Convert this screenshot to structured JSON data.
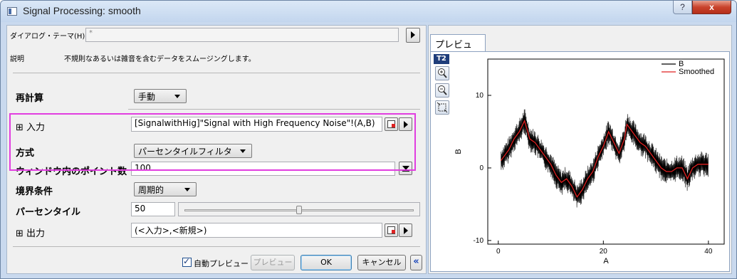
{
  "window": {
    "title": "Signal Processing: smooth",
    "help": "?",
    "close": "x"
  },
  "left": {
    "theme_label": "ダイアログ・テーマ(H)",
    "theme_value": "*",
    "description_label": "説明",
    "description_text": "不規則なあるいは雑音を含むデータをスムージングします。",
    "recalc_label": "再計算",
    "recalc_value": "手動",
    "input_label": "⊞ 入力",
    "input_value": "[SignalwithHig]\"Signal with High Frequency Noise\"!(A,B)",
    "method_label": "方式",
    "method_value": "パーセンタイルフィルタ",
    "points_label": "ウィンドウ内のポイント数",
    "points_value": "100",
    "boundary_label": "境界条件",
    "boundary_value": "周期的",
    "percentile_label": "パーセンタイル",
    "percentile_value": "50",
    "percentile_fraction": 0.5,
    "output_label": "⊞ 出力",
    "output_value": "(<入力>,<新規>)"
  },
  "buttons": {
    "auto_preview_label": "自動プレビュー",
    "auto_preview_checked": true,
    "preview": "プレビュー",
    "ok": "OK",
    "cancel": "キャンセル",
    "collapse": "«"
  },
  "preview": {
    "tab": "プレビュー",
    "layer_badge": "T2",
    "tools": [
      "zoom-in-icon",
      "zoom-out-icon",
      "rescale-icon"
    ]
  },
  "chart_data": {
    "type": "line",
    "xlabel": "A",
    "ylabel": "B",
    "xlim": [
      -2,
      43
    ],
    "ylim": [
      -10.5,
      15
    ],
    "xticks": [
      0,
      20,
      40
    ],
    "yticks": [
      -10,
      0,
      10
    ],
    "legend": {
      "position": "top-right",
      "entries": [
        {
          "name": "B",
          "color": "#000000"
        },
        {
          "name": "Smoothed",
          "color": "#e02020"
        }
      ]
    },
    "series": [
      {
        "name": "B",
        "color": "#000000",
        "noise_amplitude": 1.8
      },
      {
        "name": "Smoothed",
        "color": "#e02020",
        "x": [
          0.5,
          1,
          2,
          3,
          4,
          5,
          6,
          7,
          8,
          9,
          10,
          11,
          12,
          13,
          14,
          15,
          16,
          17,
          18,
          19,
          20,
          21,
          22,
          23,
          24,
          24.5,
          25,
          26,
          27,
          28,
          29,
          30,
          31,
          32,
          33,
          34,
          35,
          36,
          37,
          38,
          39,
          40
        ],
        "y": [
          1.0,
          1.5,
          2.5,
          4.0,
          5.0,
          6.5,
          4.0,
          3.5,
          2.5,
          1.5,
          0.5,
          -1.0,
          -2.0,
          -1.5,
          -2.5,
          -4.0,
          -3.0,
          -1.5,
          -0.5,
          1.5,
          3.0,
          5.0,
          3.5,
          2.0,
          4.0,
          6.0,
          5.5,
          4.5,
          3.5,
          3.0,
          2.0,
          1.0,
          0.0,
          -0.5,
          -0.5,
          0.0,
          0.0,
          -1.5,
          0.0,
          0.5,
          0.5,
          0.5
        ]
      }
    ]
  }
}
